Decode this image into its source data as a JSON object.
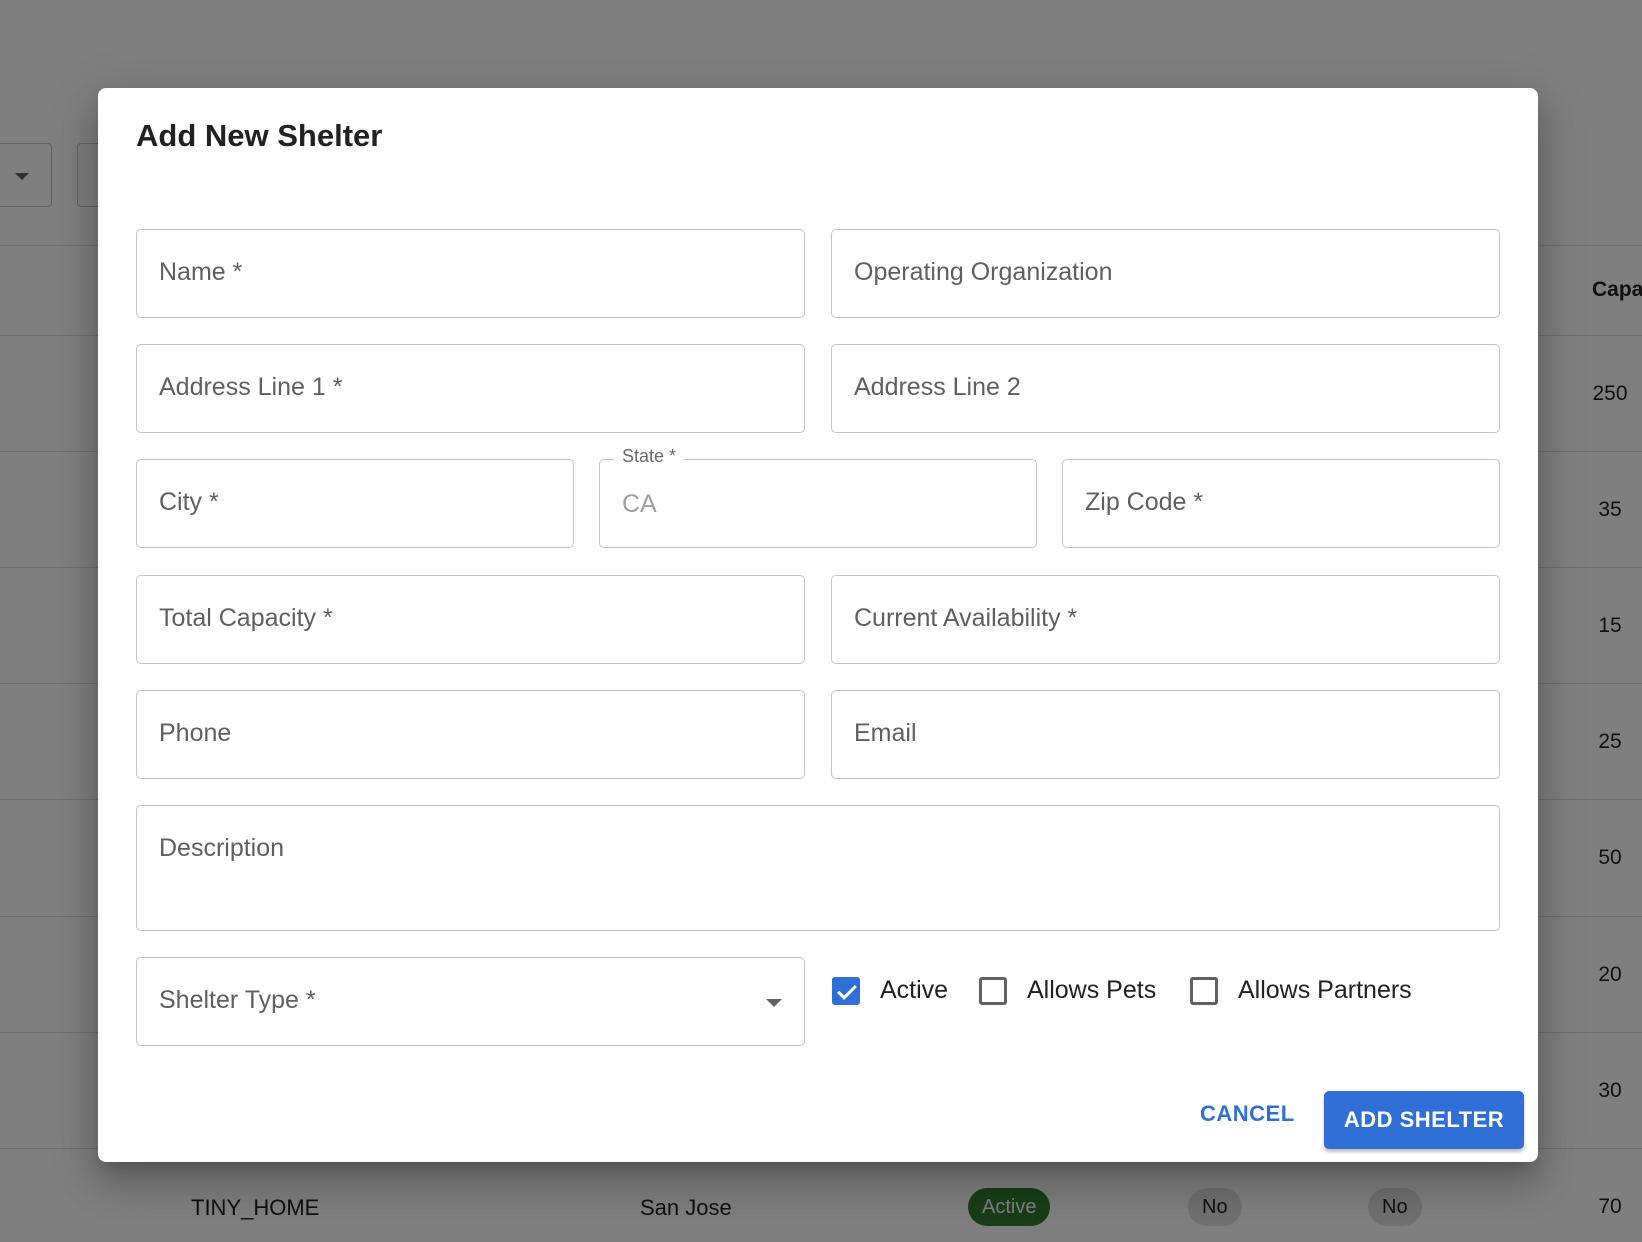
{
  "background": {
    "table": {
      "header_capacity": "Capa",
      "capacity_values": [
        "250",
        "35",
        "15",
        "25",
        "50",
        "20",
        "30",
        "70"
      ],
      "last_row": {
        "type": "TINY_HOME",
        "city": "San Jose",
        "status": "Active",
        "allows_pets": "No",
        "allows_partners": "No"
      }
    }
  },
  "dialog": {
    "title": "Add New Shelter",
    "fields": {
      "name": "Name *",
      "operating_organization": "Operating Organization",
      "address_line_1": "Address Line 1 *",
      "address_line_2": "Address Line 2",
      "city": "City *",
      "state_label": "State *",
      "state_value": "CA",
      "zip_code": "Zip Code *",
      "total_capacity": "Total Capacity *",
      "current_availability": "Current Availability *",
      "phone": "Phone",
      "email": "Email",
      "description": "Description",
      "shelter_type": "Shelter Type *"
    },
    "checkboxes": {
      "active": {
        "label": "Active",
        "checked": true
      },
      "allows_pets": {
        "label": "Allows Pets",
        "checked": false
      },
      "allows_partners": {
        "label": "Allows Partners",
        "checked": false
      }
    },
    "buttons": {
      "cancel": "CANCEL",
      "add": "ADD SHELTER"
    }
  },
  "colors": {
    "primary": "#2f6fd6",
    "active_chip": "#2e7d32"
  }
}
